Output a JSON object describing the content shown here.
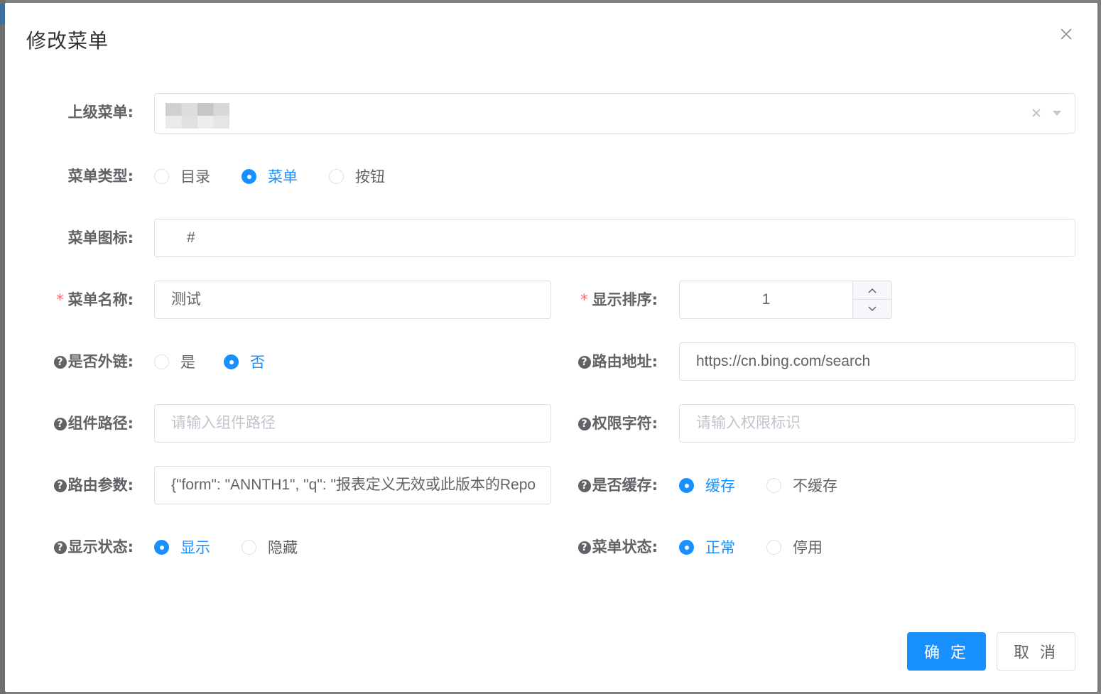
{
  "dialog": {
    "title": "修改菜单"
  },
  "form": {
    "parent_menu": {
      "label": "上级菜单:",
      "value": ""
    },
    "menu_type": {
      "label": "菜单类型:",
      "options": [
        "目录",
        "菜单",
        "按钮"
      ],
      "selected": "菜单"
    },
    "menu_icon": {
      "label": "菜单图标:",
      "value": "#"
    },
    "menu_name": {
      "label": "菜单名称:",
      "value": "测试"
    },
    "sort_order": {
      "label": "显示排序:",
      "value": "1"
    },
    "is_external": {
      "label": "是否外链:",
      "options": [
        "是",
        "否"
      ],
      "selected": "否"
    },
    "route_path": {
      "label": "路由地址:",
      "value": "https://cn.bing.com/search"
    },
    "component_path": {
      "label": "组件路径:",
      "placeholder": "请输入组件路径"
    },
    "perms": {
      "label": "权限字符:",
      "placeholder": "请输入权限标识"
    },
    "route_params": {
      "label": "路由参数:",
      "value": "{\"form\": \"ANNTH1\", \"q\": \"报表定义无效或此版本的Repo"
    },
    "is_cache": {
      "label": "是否缓存:",
      "options": [
        "缓存",
        "不缓存"
      ],
      "selected": "缓存"
    },
    "visible": {
      "label": "显示状态:",
      "options": [
        "显示",
        "隐藏"
      ],
      "selected": "显示"
    },
    "status": {
      "label": "菜单状态:",
      "options": [
        "正常",
        "停用"
      ],
      "selected": "正常"
    }
  },
  "footer": {
    "confirm_label": "确 定",
    "cancel_label": "取 消"
  },
  "colors": {
    "primary": "#1890ff",
    "required": "#f56c6c",
    "text": "#606266",
    "placeholder": "#c0c4cc"
  }
}
